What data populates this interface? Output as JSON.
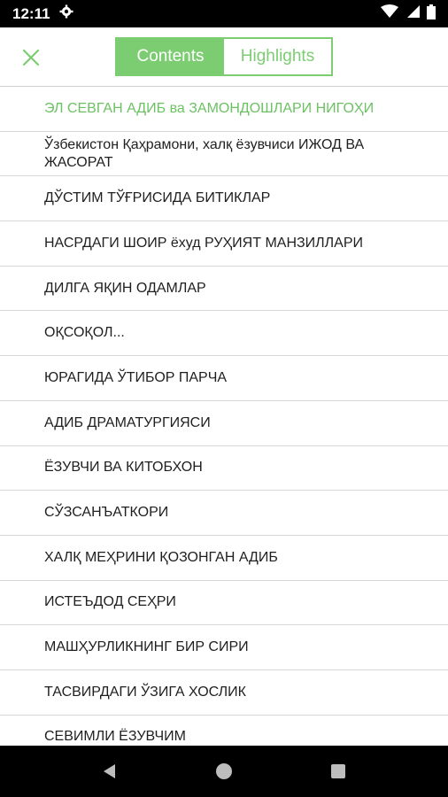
{
  "status_bar": {
    "time": "12:11"
  },
  "tabs": {
    "contents": "Contents",
    "highlights": "Highlights"
  },
  "accent_color": "#7ccd72",
  "contents": [
    "ЭЛ СЕВГАН АДИБ ва ЗАМОНДОШЛАРИ НИГОҲИ",
    "Ўзбекистон Қаҳрамони, халқ ёзувчиси ИЖОД ВА ЖАСОРАТ",
    "ДЎСТИМ ТЎҒРИСИДА БИТИКЛАР",
    "НАСРДАГИ ШОИР ёхуд РУҲИЯТ МАНЗИЛЛАРИ",
    "ДИЛГА ЯҚИН ОДАМЛАР",
    "ОҚСОҚОЛ...",
    "ЮРАГИДА ЎТИБОР ПАРЧА",
    "АДИБ ДРАМАТУРГИЯСИ",
    "ЁЗУВЧИ ВА КИТОБХОН",
    "СЎЗСАНЪАТКОРИ",
    "ХАЛҚ МЕҲРИНИ ҚОЗОНГАН АДИБ",
    "ИСТЕЪДОД СЕҲРИ",
    "МАШҲУРЛИКНИНГ БИР СИРИ",
    "ТАСВИРДАГИ ЎЗИГА ХОСЛИК",
    "СЕВИМЛИ ЁЗУВЧИМ"
  ]
}
